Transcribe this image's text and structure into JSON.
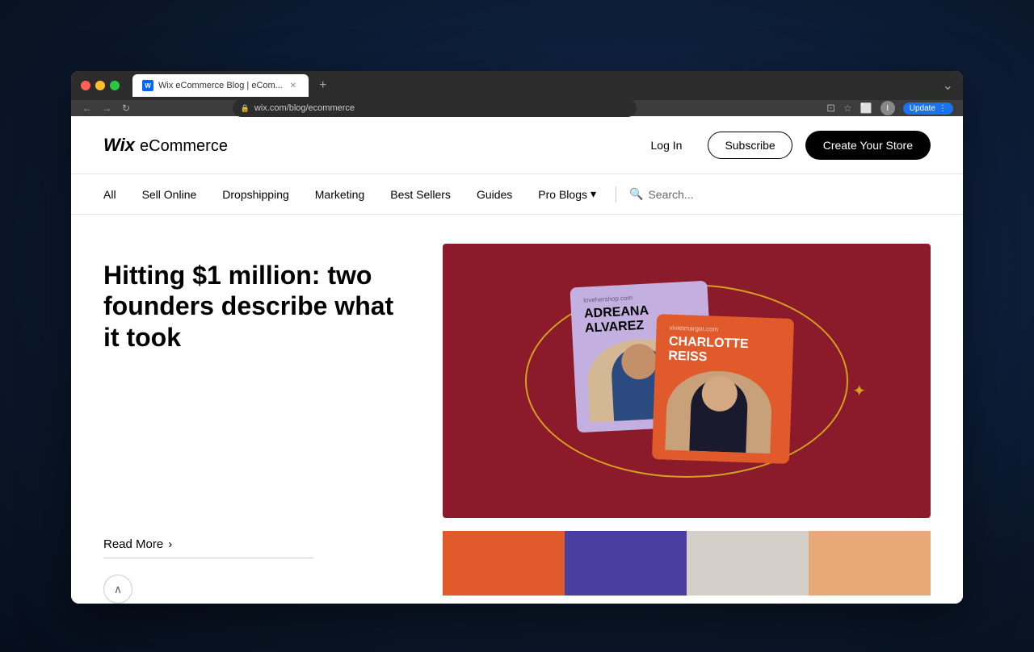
{
  "desktop": {
    "background_description": "Dark blue ocean night sky desktop background"
  },
  "browser": {
    "tab": {
      "favicon_letter": "W",
      "title": "Wix eCommerce Blog | eCom..."
    },
    "new_tab_label": "+",
    "address": "wix.com/blog/ecommerce",
    "right_controls": {
      "incognito_label": "Incognito",
      "update_label": "Update"
    }
  },
  "site": {
    "logo": {
      "wix": "Wix",
      "ecommerce": "eCommerce"
    },
    "header": {
      "login_label": "Log In",
      "subscribe_label": "Subscribe",
      "create_store_label": "Create Your Store"
    },
    "nav": {
      "items": [
        {
          "label": "All",
          "id": "all"
        },
        {
          "label": "Sell Online",
          "id": "sell-online"
        },
        {
          "label": "Dropshipping",
          "id": "dropshipping"
        },
        {
          "label": "Marketing",
          "id": "marketing"
        },
        {
          "label": "Best Sellers",
          "id": "best-sellers"
        },
        {
          "label": "Guides",
          "id": "guides"
        },
        {
          "label": "Pro Blogs",
          "id": "pro-blogs",
          "has_dropdown": true
        }
      ],
      "search_placeholder": "Search..."
    },
    "featured_article": {
      "title": "Hitting $1 million: two founders describe what it took",
      "read_more_label": "Read More",
      "hero_image": {
        "card1": {
          "site": "lovehershop.com",
          "name": "ADREANA ALVAREZ"
        },
        "card2": {
          "site": "vivietmargot.com",
          "name": "CHARLOTTE REISS"
        }
      }
    },
    "bottom_cards": {
      "colors": [
        "#e05a2b",
        "#4a3fa0",
        "#d4cfc8",
        "#e8a878"
      ]
    }
  }
}
